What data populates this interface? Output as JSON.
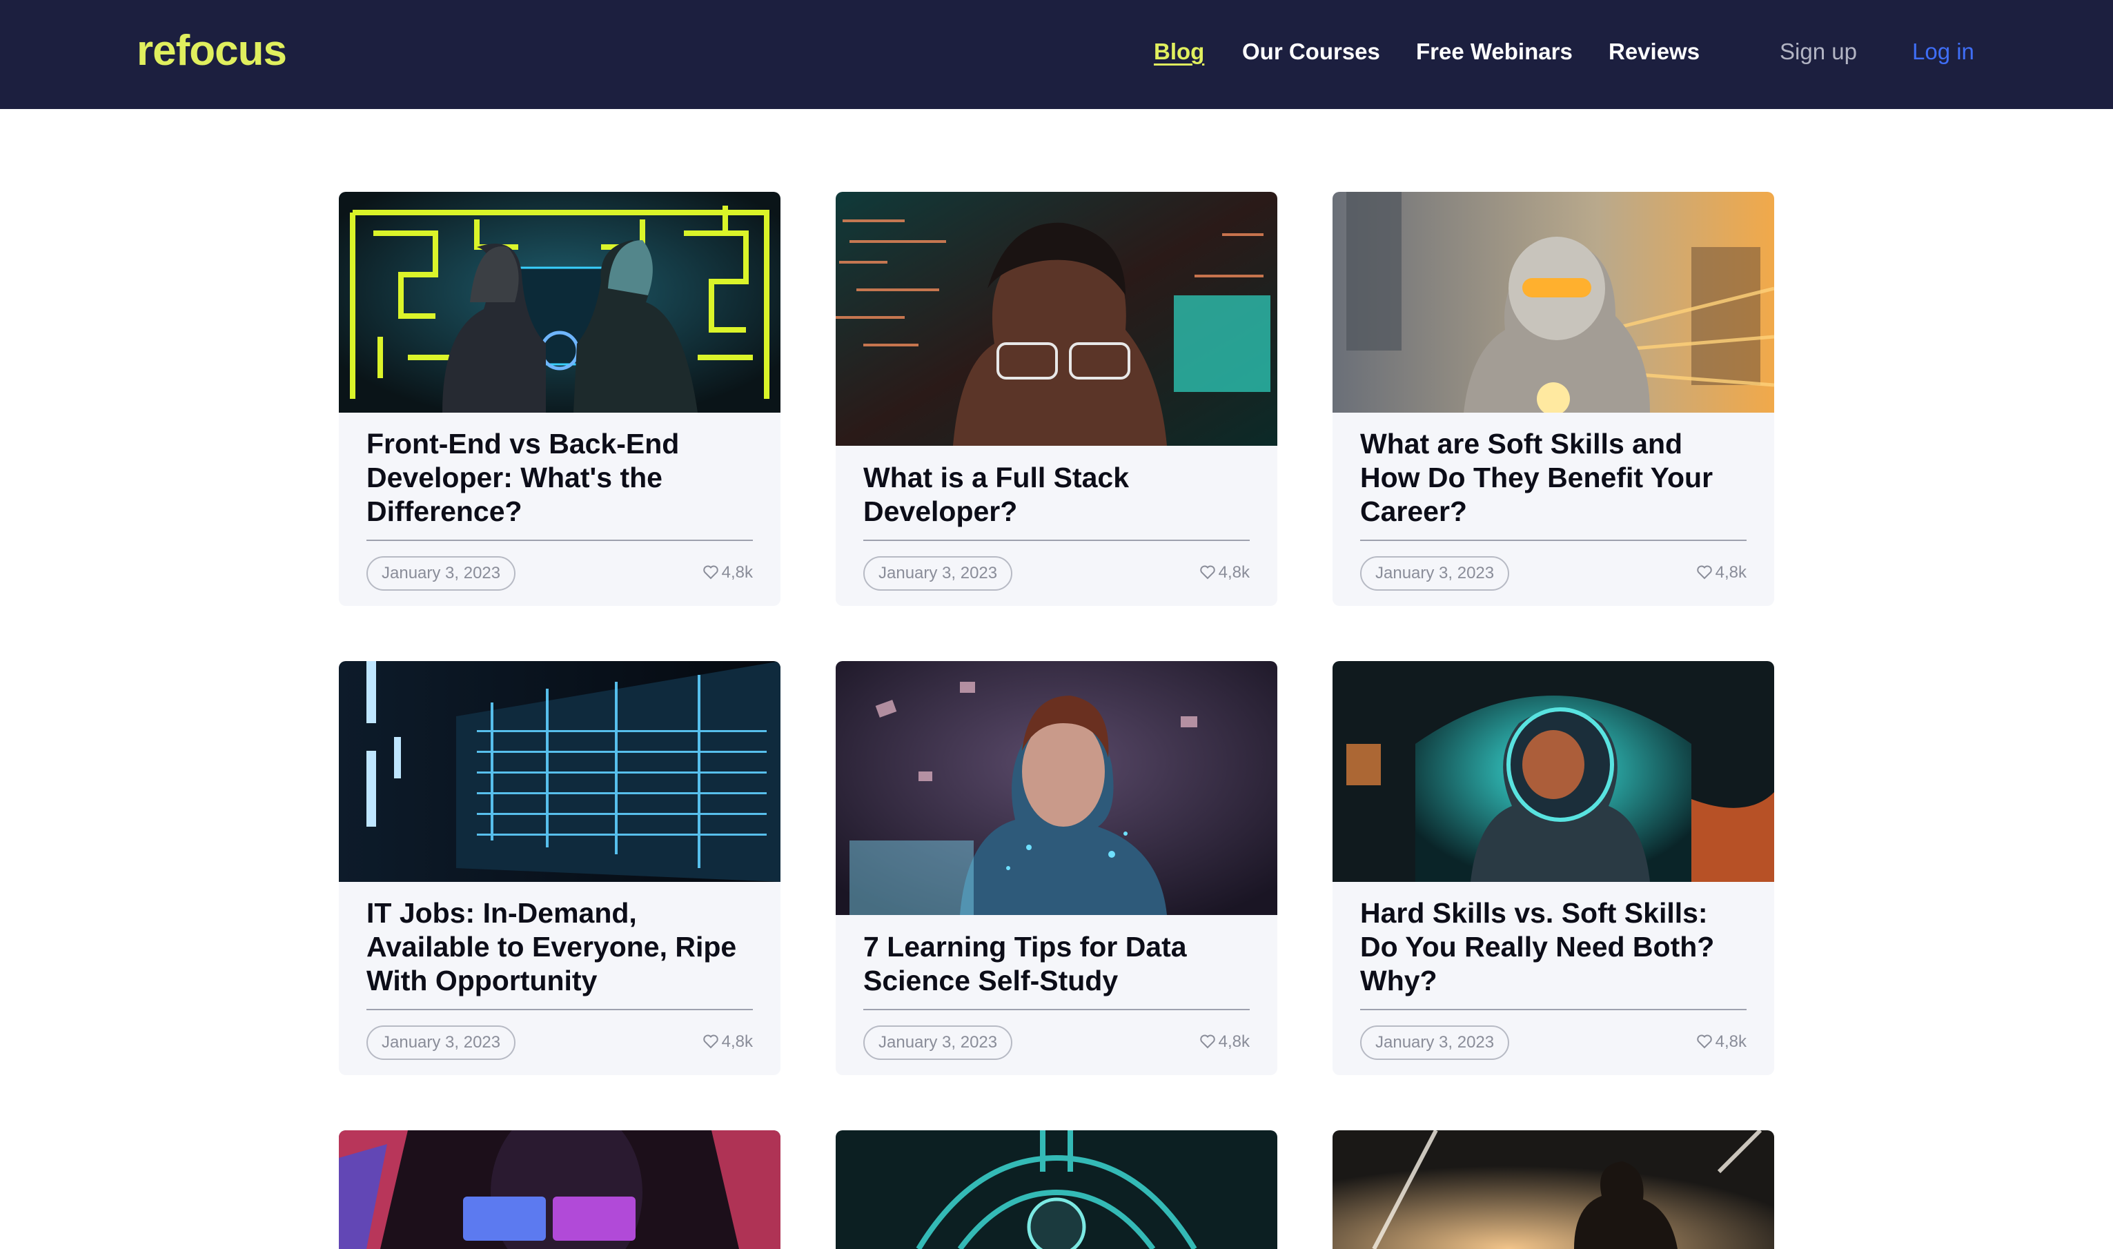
{
  "brand": {
    "name": "refocus"
  },
  "nav": {
    "blog": "Blog",
    "courses": "Our Courses",
    "webinars": "Free Webinars",
    "reviews": "Reviews",
    "signup": "Sign up",
    "login": "Log in"
  },
  "colors": {
    "header_bg": "#1c1f3f",
    "accent": "#e0ef5e",
    "link": "#3f6ef6",
    "card_bg": "#f5f6fa"
  },
  "posts": [
    {
      "title": "Front-End vs Back-End Developer: What's the Difference?",
      "date": "January 3, 2023",
      "likes": "4,8k",
      "image": "two-developers-neon-maze"
    },
    {
      "title": "What is a Full Stack Developer?",
      "date": "January 3, 2023",
      "likes": "4,8k",
      "image": "developer-code-glasses"
    },
    {
      "title": "What are Soft Skills and How Do They Benefit Your Career?",
      "date": "January 3, 2023",
      "likes": "4,8k",
      "image": "robot-motorcyclist"
    },
    {
      "title": "IT Jobs: In-Demand, Available to Everyone, Ripe With Opportunity",
      "date": "January 3, 2023",
      "likes": "4,8k",
      "image": "digital-code-city"
    },
    {
      "title": "7 Learning Tips for Data Science Self-Study",
      "date": "January 3, 2023",
      "likes": "4,8k",
      "image": "cyborg-woman-laptop"
    },
    {
      "title": "Hard Skills vs. Soft Skills: Do You Really Need Both? Why?",
      "date": "January 3, 2023",
      "likes": "4,8k",
      "image": "astronaut-neon-portal"
    },
    {
      "title": "",
      "date": "",
      "likes": "",
      "image": "vr-headset-neon"
    },
    {
      "title": "",
      "date": "",
      "likes": "",
      "image": "cyber-machine"
    },
    {
      "title": "",
      "date": "",
      "likes": "",
      "image": "silhouette-city-light"
    }
  ]
}
